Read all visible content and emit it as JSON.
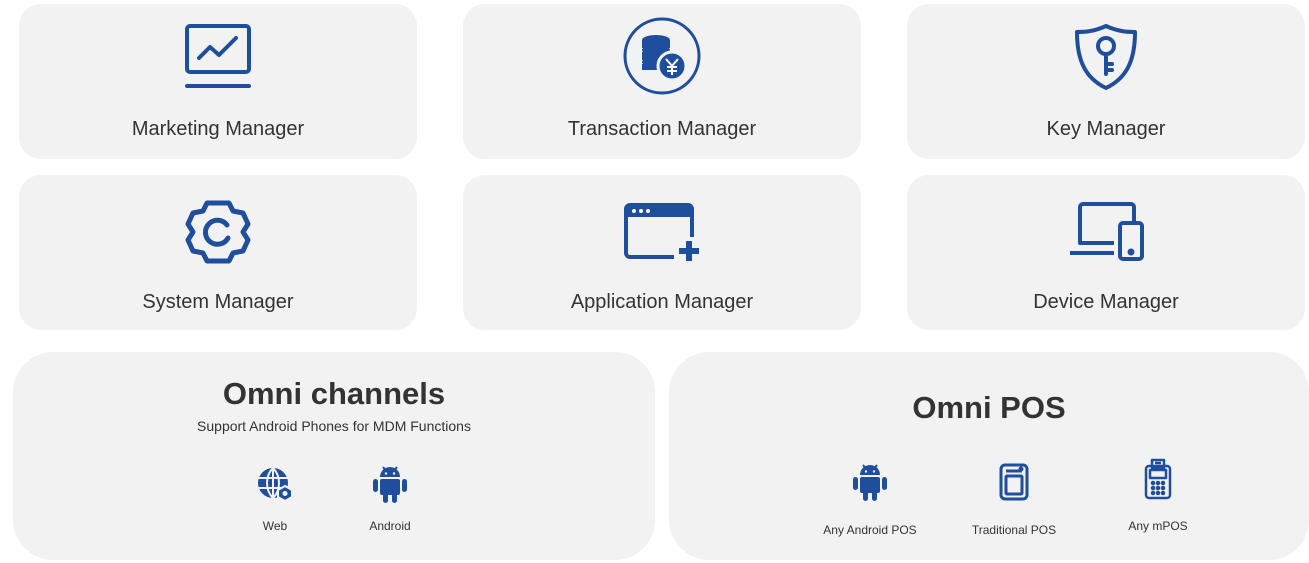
{
  "managers": [
    {
      "label": "Marketing Manager",
      "icon": "monitor-chart-icon"
    },
    {
      "label": "Transaction Manager",
      "icon": "coins-yuan-icon"
    },
    {
      "label": "Key Manager",
      "icon": "shield-key-icon"
    },
    {
      "label": "System Manager",
      "icon": "gear-icon"
    },
    {
      "label": "Application Manager",
      "icon": "browser-add-icon"
    },
    {
      "label": "Device Manager",
      "icon": "laptop-phone-icon"
    }
  ],
  "omni_channels": {
    "title": "Omni channels",
    "subtitle": "Support Android Phones for MDM Functions",
    "items": [
      {
        "label": "Web",
        "icon": "web-settings-icon"
      },
      {
        "label": "Android",
        "icon": "android-icon"
      }
    ]
  },
  "omni_pos": {
    "title": "Omni POS",
    "items": [
      {
        "label": "Any Android POS",
        "icon": "android-icon"
      },
      {
        "label": "Traditional POS",
        "icon": "pos-terminal-icon"
      },
      {
        "label": "Any mPOS",
        "icon": "mpos-icon"
      }
    ]
  },
  "colors": {
    "accent": "#1f4e9c",
    "card_bg": "#f2f2f2",
    "text": "#333333"
  }
}
